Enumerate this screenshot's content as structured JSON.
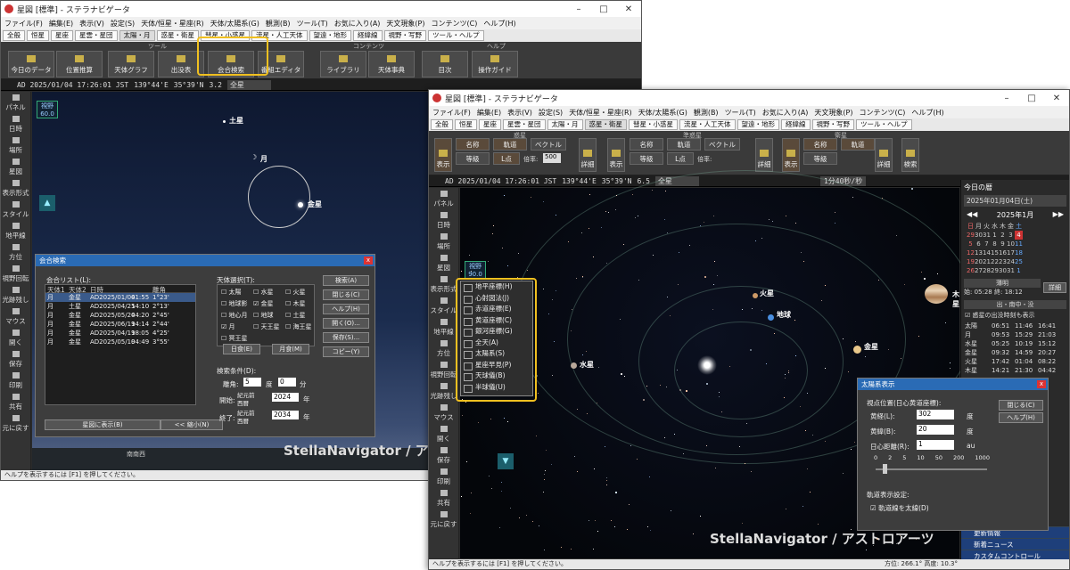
{
  "win1": {
    "title": "星図 [標準] - ステラナビゲータ",
    "menu": [
      "ファイル(F)",
      "編集(E)",
      "表示(V)",
      "設定(S)",
      "天体/恒星・星座(R)",
      "天体/太陽系(G)",
      "観測(B)",
      "ツール(T)",
      "お気に入り(A)",
      "天文現象(P)",
      "コンテンツ(C)",
      "ヘルプ(H)"
    ],
    "tabs": [
      "全般",
      "恒星",
      "星座",
      "星雲・星団",
      "太陽・月",
      "惑星・衛星",
      "彗星・小惑星",
      "流星・人工天体",
      "望遠・地形",
      "経緯線",
      "視野・写野",
      "ツール・ヘルプ"
    ],
    "ribbon_groups": [
      "ツール",
      "コンテンツ",
      "ヘルプ"
    ],
    "ribbon": [
      "今日のデータ",
      "位置推算",
      "天体グラフ",
      "出没表",
      "会合検索",
      "番組エディタ",
      "ライブラリ",
      "天体事典",
      "目次",
      "操作ガイド"
    ],
    "status": {
      "date": "AD 2025/01/04 17:26:01 JST",
      "lon": "139°44'E",
      "lat": "35°39'N",
      "mag": "3.2",
      "target": "全星"
    },
    "sidebar": [
      "パネル",
      "日時",
      "場所",
      "星図",
      "表示形式",
      "スタイル",
      "地平線",
      "方位",
      "視野回転",
      "光跡残し",
      "マウス",
      "開く",
      "保存",
      "印刷",
      "共有",
      "元に戻す"
    ],
    "sky_labels": {
      "saturn": "土星",
      "moon": "月",
      "venus": "金星",
      "fov": "視野",
      "fov_val": "60.0"
    },
    "watermark": "StellaNavigator / ア",
    "bottom_text": "南南西",
    "help": "ヘルプを表示するには [F1] を押してください。"
  },
  "dialog1": {
    "title": "会合検索",
    "list_label": "会合リスト(L):",
    "cols": [
      "天体1",
      "天体2",
      "日時",
      "離角"
    ],
    "rows": [
      [
        "月",
        "金星",
        "AD2025/01/04",
        "01:55",
        "1°23'"
      ],
      [
        "月",
        "土星",
        "AD2025/04/25",
        "14:10",
        "2°13'"
      ],
      [
        "月",
        "金星",
        "AD2025/05/24",
        "04:20",
        "2°45'"
      ],
      [
        "月",
        "金星",
        "AD2025/06/19",
        "14:14",
        "2°44'"
      ],
      [
        "月",
        "金星",
        "AD2025/04/19",
        "18:05",
        "4°25'"
      ],
      [
        "月",
        "金星",
        "AD2025/05/19",
        "04:49",
        "3°55'"
      ]
    ],
    "bodies_label": "天体選択(T):",
    "bodies": [
      "太陽",
      "水星",
      "火星",
      "地球影",
      "金星",
      "木星",
      "地心月",
      "地球",
      "土星",
      "月",
      "天王星",
      "海王星",
      "冥王星"
    ],
    "btns": [
      "検索(A)",
      "閉じる(C)",
      "ヘルプ(H)",
      "開く(O)...",
      "保存(S)...",
      "コピー(Y)"
    ],
    "sub": [
      "日食(E)",
      "月食(M)"
    ],
    "cond": "検索条件(D):",
    "sep": "離角:",
    "sep_vals": [
      "5",
      "0"
    ],
    "start": "開始:",
    "end": "終了:",
    "era1": "紀元前",
    "era2": "西暦",
    "y1": "2024",
    "y2": "2034",
    "year": "年",
    "deg": "度",
    "min": "分",
    "show_btn": "星図に表示(B)",
    "shrink_btn": "<< 縮小(N)"
  },
  "win2": {
    "title": "星図 [標準] - ステラナビゲータ",
    "tabs": [
      "全般",
      "恒星",
      "星座",
      "星雲・星団",
      "太陽・月",
      "惑星・衛星",
      "彗星・小惑星",
      "流星・人工天体",
      "望遠・地形",
      "経緯線",
      "視野・写野",
      "ツール・ヘルプ"
    ],
    "ribbon_groups": [
      "惑星",
      "準惑星",
      "衛星"
    ],
    "ribbon_labels": [
      "表示",
      "名称",
      "軌道",
      "ベクトル",
      "等級",
      "L点",
      "倍率:",
      "500",
      "詳細",
      "検索"
    ],
    "status": {
      "date": "AD 2025/01/04 17:26:01 JST",
      "lon": "139°44'E",
      "lat": "35°39'N",
      "mag": "6.5",
      "target": "全星",
      "speed": "1分40秒/秒"
    },
    "sky_labels": {
      "mars": "火星",
      "earth": "地球",
      "jupiter": "木星",
      "venus": "金星",
      "mercury": "水星",
      "fov": "視野",
      "fov_val": "90.0"
    },
    "ctx_menu": [
      "地平座標(H)",
      "心射図法(J)",
      "赤道座標(E)",
      "黄道座標(C)",
      "銀河座標(G)",
      "全天(A)",
      "太陽系(S)",
      "星座早見(P)",
      "天球儀(B)",
      "半球儀(U)"
    ],
    "watermark": "StellaNavigator / アストロアーツ",
    "help": "ヘルプを表示するには [F1] を押してください。",
    "coords": "方位: 266.1°  高度: 10.3°"
  },
  "dialog2": {
    "title": "太陽系表示",
    "view_label": "視点位置(日心黄道座標):",
    "lon_lbl": "黄経(L):",
    "lon": "302",
    "lat_lbl": "黄緯(B):",
    "lat": "20",
    "dist_lbl": "日心距離(R):",
    "dist": "1",
    "deg": "度",
    "au": "au",
    "ticks": [
      "0",
      "2",
      "5",
      "10",
      "50",
      "200",
      "1000"
    ],
    "orbit_lbl": "軌道表示設定:",
    "orbit_chk": "軌道線を太線(D)",
    "btns": [
      "閉じる(C)",
      "ヘルプ(H)"
    ]
  },
  "rpanel": {
    "today": "今日の暦",
    "date": "2025年01月04日(土)",
    "month": "2025年1月",
    "dow": [
      "日",
      "月",
      "火",
      "水",
      "木",
      "金",
      "土"
    ],
    "weeks": [
      [
        "29",
        "30",
        "31",
        "1",
        "2",
        "3",
        "4"
      ],
      [
        "5",
        "6",
        "7",
        "8",
        "9",
        "10",
        "11"
      ],
      [
        "12",
        "13",
        "14",
        "15",
        "16",
        "17",
        "18"
      ],
      [
        "19",
        "20",
        "21",
        "22",
        "23",
        "24",
        "25"
      ],
      [
        "26",
        "27",
        "28",
        "29",
        "30",
        "31",
        "1"
      ]
    ],
    "moon_lbl": "薄明",
    "dawn": "始: 05:28",
    "dusk": "終: 18:12",
    "detail": "詳細",
    "rise_lbl": "出・南中・没",
    "chk": "惑星の出没時刻も表示",
    "rise": [
      [
        "太陽",
        "06:51",
        "11:46",
        "16:41"
      ],
      [
        "月",
        "09:53",
        "15:29",
        "21:03"
      ],
      [
        "水星",
        "05:25",
        "10:19",
        "15:12"
      ],
      [
        "金星",
        "09:32",
        "14:59",
        "20:27"
      ],
      [
        "火星",
        "17:42",
        "01:04",
        "08:22"
      ],
      [
        "木星",
        "14:21",
        "21:30",
        "04:42"
      ]
    ],
    "links": [
      "更新情報",
      "新着ニュース",
      "カスタムコントロール"
    ]
  }
}
